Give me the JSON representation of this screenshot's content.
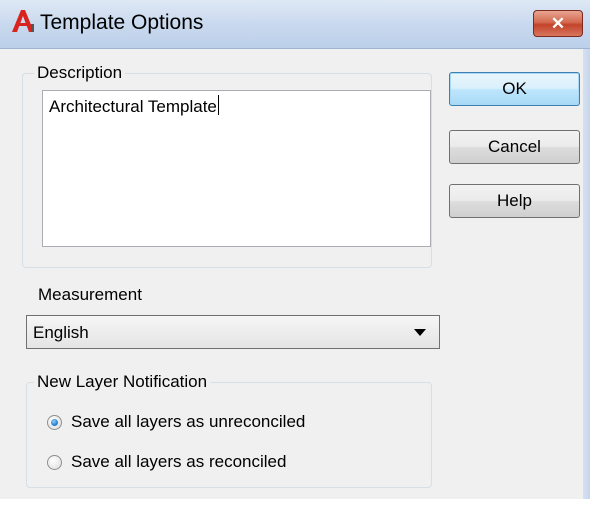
{
  "window": {
    "title": "Template Options",
    "close_glyph": "✕",
    "app_icon": "autocad-icon"
  },
  "description": {
    "group_label": "Description",
    "value": "Architectural Template"
  },
  "buttons": {
    "ok": "OK",
    "cancel": "Cancel",
    "help": "Help"
  },
  "measurement": {
    "label": "Measurement",
    "selected": "English"
  },
  "new_layer_notification": {
    "group_label": "New Layer Notification",
    "options": [
      {
        "label": "Save all layers as unreconciled",
        "checked": true
      },
      {
        "label": "Save all layers as reconciled",
        "checked": false
      }
    ]
  },
  "colors": {
    "titlebar": "#c9d9ee",
    "close_button": "#c2432a",
    "dialog_bg": "#f0f0f0",
    "accent": "#3c7fb1"
  }
}
